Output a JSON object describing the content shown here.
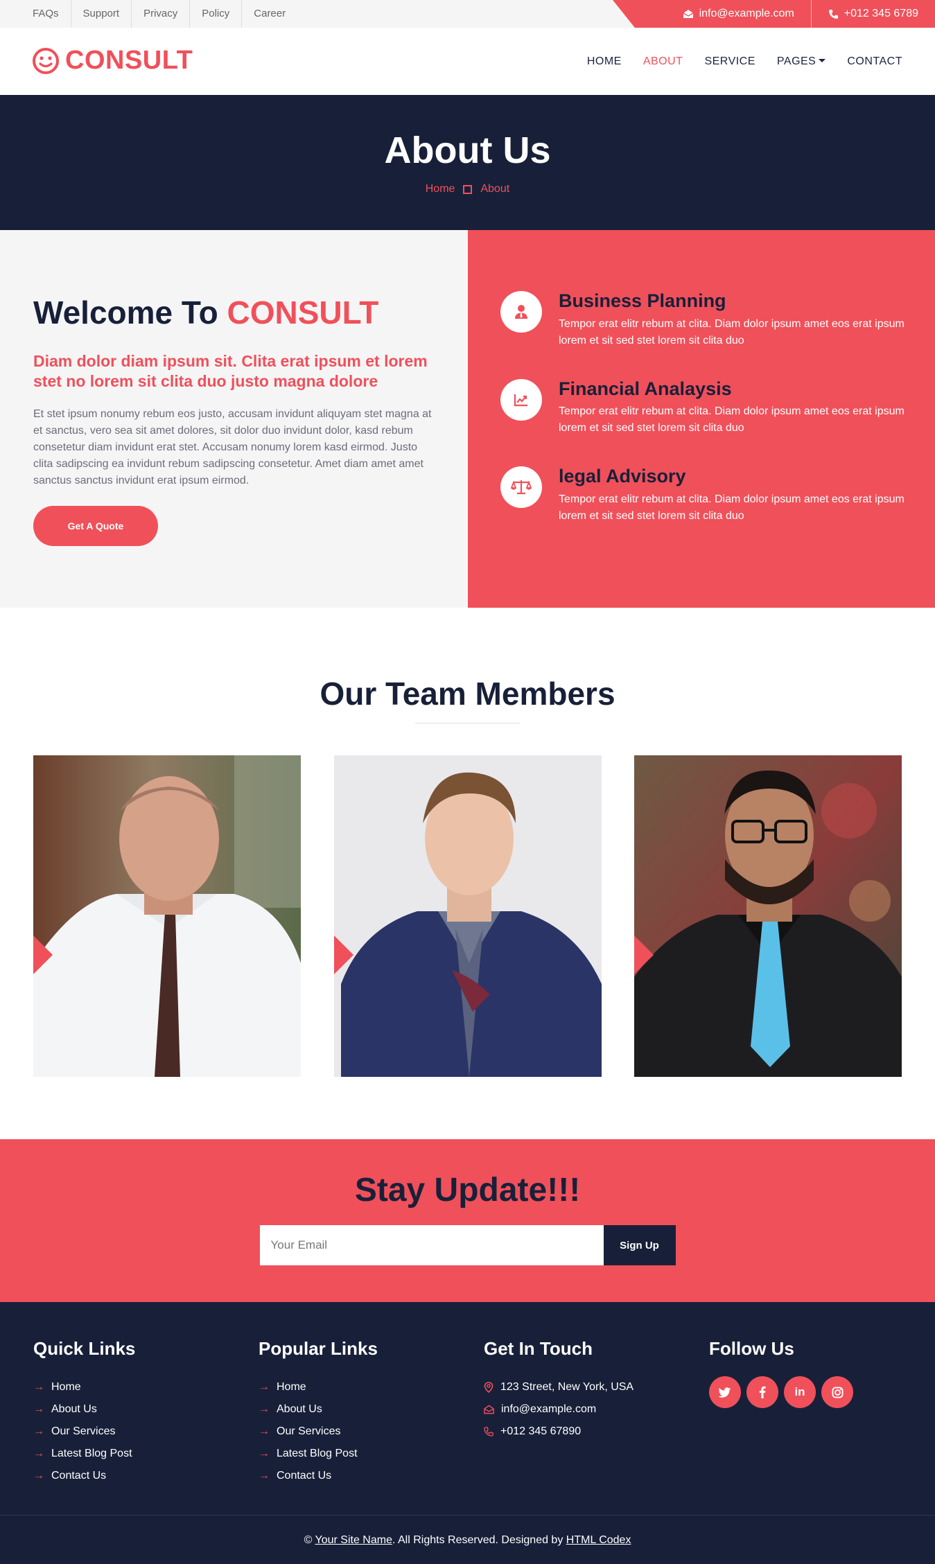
{
  "topbar": {
    "links": [
      "FAQs",
      "Support",
      "Privacy",
      "Policy",
      "Career"
    ],
    "email": "info@example.com",
    "phone": "+012 345 6789"
  },
  "brand": {
    "name": "CONSULT"
  },
  "nav": {
    "items": [
      "HOME",
      "ABOUT",
      "SERVICE",
      "PAGES",
      "CONTACT"
    ],
    "active": "ABOUT"
  },
  "hero": {
    "title": "About Us",
    "breadcrumb": [
      "Home",
      "About"
    ]
  },
  "about": {
    "title_prefix": "Welcome To",
    "title_brand": "CONSULT",
    "subtitle": "Diam dolor diam ipsum sit. Clita erat ipsum et lorem stet no lorem sit clita duo justo magna dolore",
    "body": "Et stet ipsum nonumy rebum eos justo, accusam invidunt aliquyam stet magna at et sanctus, vero sea sit amet dolores, sit dolor duo invidunt dolor, kasd rebum consetetur diam invidunt erat stet. Accusam nonumy lorem kasd eirmod. Justo clita sadipscing ea invidunt rebum sadipscing consetetur. Amet diam amet amet sanctus sanctus invidunt erat ipsum eirmod.",
    "button": "Get A Quote",
    "services": [
      {
        "title": "Business Planning",
        "text": "Tempor erat elitr rebum at clita. Diam dolor ipsum amet eos erat ipsum lorem et sit sed stet lorem sit clita duo",
        "icon": "user-tie-icon"
      },
      {
        "title": "Financial Analaysis",
        "text": "Tempor erat elitr rebum at clita. Diam dolor ipsum amet eos erat ipsum lorem et sit sed stet lorem sit clita duo",
        "icon": "chart-line-icon"
      },
      {
        "title": "legal Advisory",
        "text": "Tempor erat elitr rebum at clita. Diam dolor ipsum amet eos erat ipsum lorem et sit sed stet lorem sit clita duo",
        "icon": "balance-scale-icon"
      }
    ]
  },
  "team": {
    "title": "Our Team Members"
  },
  "newsletter": {
    "title": "Stay Update!!!",
    "placeholder": "Your Email",
    "button": "Sign Up"
  },
  "footer": {
    "quick_title": "Quick Links",
    "quick_links": [
      "Home",
      "About Us",
      "Our Services",
      "Latest Blog Post",
      "Contact Us"
    ],
    "popular_title": "Popular Links",
    "popular_links": [
      "Home",
      "About Us",
      "Our Services",
      "Latest Blog Post",
      "Contact Us"
    ],
    "touch_title": "Get In Touch",
    "address": "123 Street, New York, USA",
    "email": "info@example.com",
    "phone": "+012 345 67890",
    "follow_title": "Follow Us",
    "copyright_prefix": "©",
    "site_name": "Your Site Name",
    "copyright_mid": ". All Rights Reserved. Designed by",
    "designer": "HTML Codex"
  },
  "colors": {
    "accent": "#f0505a",
    "dark": "#182039"
  }
}
